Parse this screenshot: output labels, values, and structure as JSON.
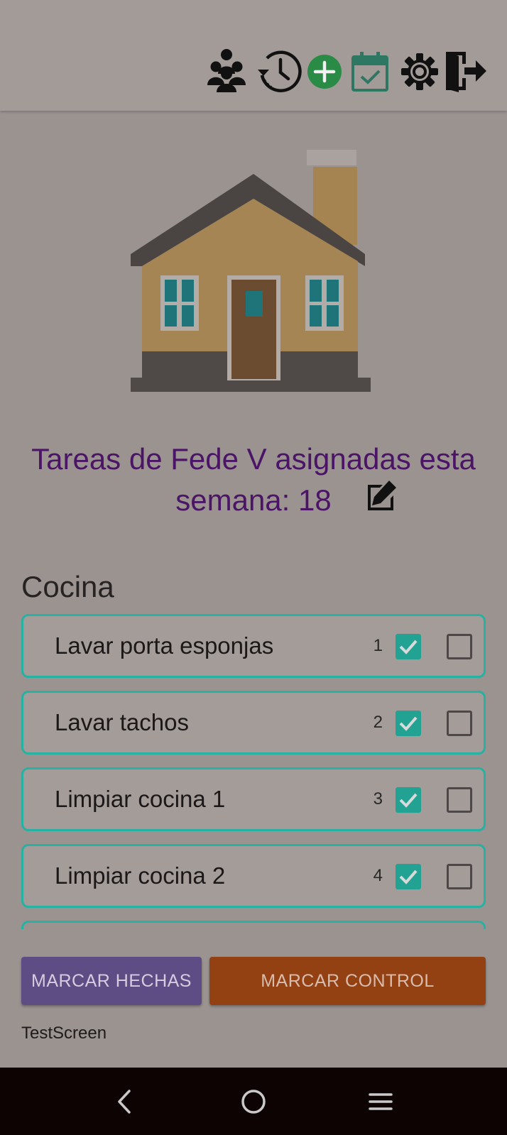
{
  "topbar": {
    "icons": [
      "people-group-icon",
      "history-icon",
      "add-circle-icon",
      "calendar-check-icon",
      "gear-icon",
      "logout-icon"
    ]
  },
  "header": {
    "title": "Tareas de Fede V asignadas esta semana: 18"
  },
  "section": {
    "title": "Cocina"
  },
  "tasks": [
    {
      "name": "Lavar porta esponjas",
      "number": "1",
      "done": true,
      "control": false
    },
    {
      "name": "Lavar tachos",
      "number": "2",
      "done": true,
      "control": false
    },
    {
      "name": "Limpiar cocina 1",
      "number": "3",
      "done": true,
      "control": false
    },
    {
      "name": "Limpiar cocina 2",
      "number": "4",
      "done": true,
      "control": false
    }
  ],
  "buttons": {
    "mark_done": "MARCAR HECHAS",
    "mark_control": "MARCAR CONTROL"
  },
  "footer": {
    "label": "TestScreen"
  },
  "colors": {
    "accent_teal": "#27b1a2",
    "title_purple": "#4b1466",
    "button_purple": "#5e4d84",
    "button_orange": "#934012",
    "add_green": "#2a8b47"
  }
}
